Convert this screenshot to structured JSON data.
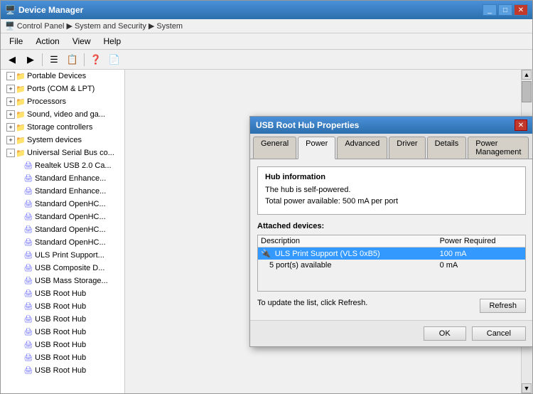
{
  "window": {
    "title": "Device Manager",
    "breadcrumb": "Control Panel > System and Security > System"
  },
  "menu": {
    "items": [
      "File",
      "Action",
      "View",
      "Help"
    ]
  },
  "tree": {
    "items": [
      {
        "label": "Portable Devices",
        "indent": 1,
        "icon": "folder",
        "expanded": true
      },
      {
        "label": "Ports (COM & LPT)",
        "indent": 1,
        "icon": "folder",
        "expanded": false
      },
      {
        "label": "Processors",
        "indent": 1,
        "icon": "folder",
        "expanded": false
      },
      {
        "label": "Sound, video and ga...",
        "indent": 1,
        "icon": "folder",
        "expanded": false
      },
      {
        "label": "Storage controllers",
        "indent": 1,
        "icon": "folder",
        "expanded": false
      },
      {
        "label": "System devices",
        "indent": 1,
        "icon": "folder",
        "expanded": false
      },
      {
        "label": "Universal Serial Bus co...",
        "indent": 1,
        "icon": "folder",
        "expanded": true
      },
      {
        "label": "Realtek USB 2.0 Ca...",
        "indent": 2,
        "icon": "device"
      },
      {
        "label": "Standard Enhance...",
        "indent": 2,
        "icon": "device"
      },
      {
        "label": "Standard Enhance...",
        "indent": 2,
        "icon": "device"
      },
      {
        "label": "Standard OpenHC...",
        "indent": 2,
        "icon": "device"
      },
      {
        "label": "Standard OpenHC...",
        "indent": 2,
        "icon": "device"
      },
      {
        "label": "Standard OpenHC...",
        "indent": 2,
        "icon": "device"
      },
      {
        "label": "Standard OpenHC...",
        "indent": 2,
        "icon": "device"
      },
      {
        "label": "ULS Print Support...",
        "indent": 2,
        "icon": "device"
      },
      {
        "label": "USB Composite D...",
        "indent": 2,
        "icon": "device"
      },
      {
        "label": "USB Mass Storage...",
        "indent": 2,
        "icon": "device"
      },
      {
        "label": "USB Root Hub",
        "indent": 2,
        "icon": "device"
      },
      {
        "label": "USB Root Hub",
        "indent": 2,
        "icon": "device"
      },
      {
        "label": "USB Root Hub",
        "indent": 2,
        "icon": "device"
      },
      {
        "label": "USB Root Hub",
        "indent": 2,
        "icon": "device"
      },
      {
        "label": "USB Root Hub",
        "indent": 2,
        "icon": "device"
      },
      {
        "label": "USB Root Hub",
        "indent": 2,
        "icon": "device"
      },
      {
        "label": "USB Root Hub",
        "indent": 2,
        "icon": "device"
      }
    ]
  },
  "dialog": {
    "title": "USB Root Hub Properties",
    "tabs": [
      "General",
      "Power",
      "Advanced",
      "Driver",
      "Details",
      "Power Management"
    ],
    "active_tab": "Power",
    "hub_info": {
      "label": "Hub information",
      "self_powered": "The hub is self-powered.",
      "power_available": "Total power available:  500 mA per port"
    },
    "attached_devices": {
      "label": "Attached devices:",
      "columns": [
        "Description",
        "Power Required"
      ],
      "rows": [
        {
          "description": "ULS Print Support (VLS 0xB5)",
          "power": "100 mA",
          "selected": true
        },
        {
          "description": "5 port(s) available",
          "power": "0 mA",
          "selected": false
        }
      ]
    },
    "update_text": "To update the list, click Refresh.",
    "refresh_label": "Refresh",
    "ok_label": "OK",
    "cancel_label": "Cancel"
  }
}
